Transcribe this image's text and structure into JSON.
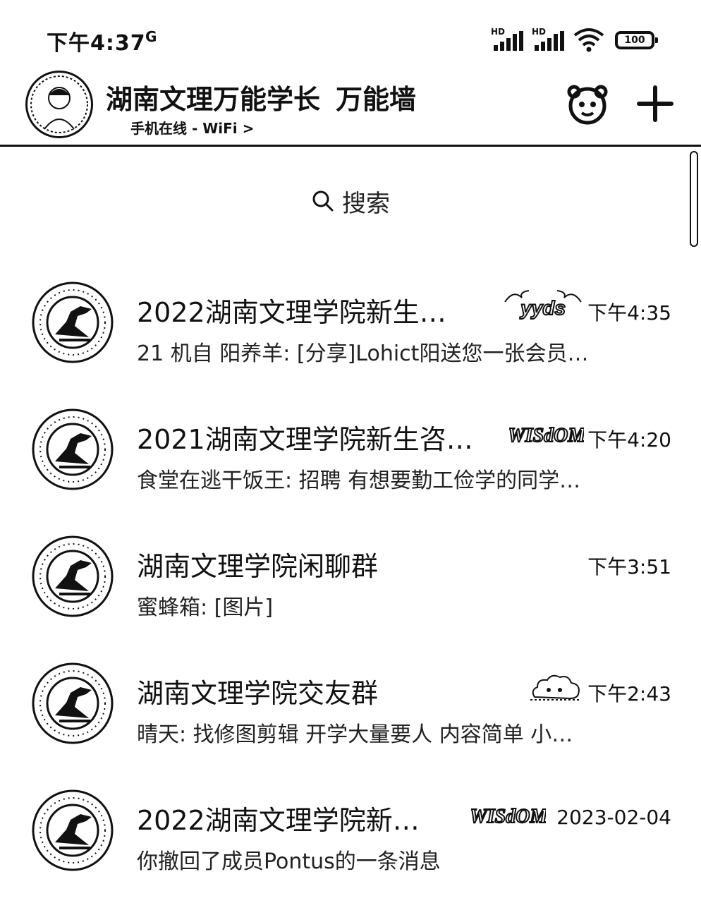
{
  "status_bar": {
    "time": "下午4:37",
    "sub_icon": "G",
    "signal_1_label": "HD",
    "signal_2_label": "HD",
    "battery": "100",
    "icons": [
      "signal-icon",
      "signal-icon",
      "wifi-icon",
      "battery-icon"
    ]
  },
  "header": {
    "title": "湖南文理万能学长",
    "title_suffix": "万能墙",
    "subtitle": "手机在线 - WiFi >",
    "buttons": [
      "theme-icon",
      "plus-icon"
    ]
  },
  "search": {
    "label": "搜索",
    "icon": "search-icon"
  },
  "chats": [
    {
      "name": "2022湖南文理学院新生…",
      "preview": "21 机自 阳养羊: [分享]Lohict阳送您一张会员…",
      "time": "下午4:35",
      "badge": "yyds"
    },
    {
      "name": "2021湖南文理学院新生咨…",
      "preview": "食堂在逃干饭王: 招聘  有想要勤工俭学的同学…",
      "time": "下午4:20",
      "badge": "WISdOM"
    },
    {
      "name": "湖南文理学院闲聊群",
      "preview": "蜜蜂箱: [图片]",
      "time": "下午3:51",
      "badge": ""
    },
    {
      "name": "湖南文理学院交友群",
      "preview": "晴天: 找修图剪辑  开学大量要人  内容简单  小…",
      "time": "下午2:43",
      "badge": "cloud"
    },
    {
      "name": "2022湖南文理学院新…",
      "preview": "你撤回了成员Pontus的一条消息",
      "time": "2023-02-04",
      "badge": "WISdOM"
    }
  ]
}
